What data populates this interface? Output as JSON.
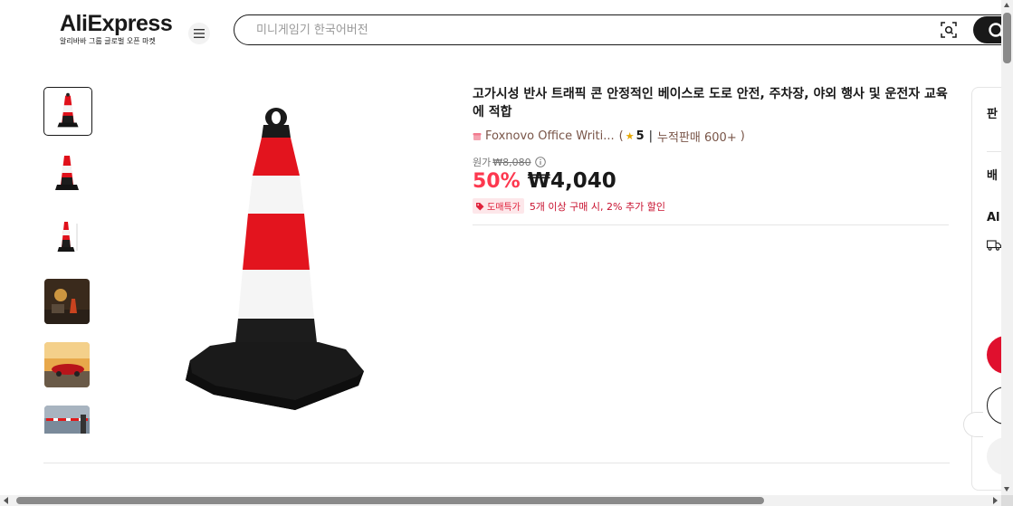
{
  "header": {
    "logo_text": "AliExpress",
    "logo_subtitle": "알리바바 그룹 글로벌 오픈 마켓",
    "menu_icon": "hamburger-menu-icon",
    "search": {
      "placeholder": "미니게임기 한국어버전",
      "camera_icon": "camera-search-icon",
      "button_icon": "search-icon"
    }
  },
  "gallery": {
    "thumbnails": [
      {
        "alt": "traffic cone thumbnail 1",
        "selected": true
      },
      {
        "alt": "traffic cone thumbnail 2"
      },
      {
        "alt": "traffic cone thumbnail 3"
      },
      {
        "alt": "night roadside scene thumbnail"
      },
      {
        "alt": "red car on road thumbnail"
      },
      {
        "alt": "barrier gate thumbnail"
      }
    ],
    "main_image_alt": "빨간색과 흰색 반사 띠가 있는 검은색 베이스의 트래픽 콘"
  },
  "product": {
    "title": "고가시성 반사 트래픽 콘 안정적인 베이스로 도로 안전, 주차장, 야외 행사 및 운전자 교육에 적합",
    "store_name": "Foxnovo Office Writi...",
    "paren_open": "(",
    "rating": "5",
    "separator": "|",
    "sales": "누적판매 600+",
    "paren_close": ")",
    "original_label": "원가",
    "original_price": "₩8,080",
    "discount": "50%",
    "price": "₩4,040",
    "promo_badge": "도매특가",
    "promo_text": "5개 이상 구매 시, 2% 추가 할인"
  },
  "right_panel": {
    "label_1": "판",
    "label_2": "배",
    "label_3": "Al"
  },
  "colors": {
    "accent_red": "#fd384f",
    "promo_red": "#c8102e",
    "store_brown": "#795548",
    "dark": "#191919"
  }
}
